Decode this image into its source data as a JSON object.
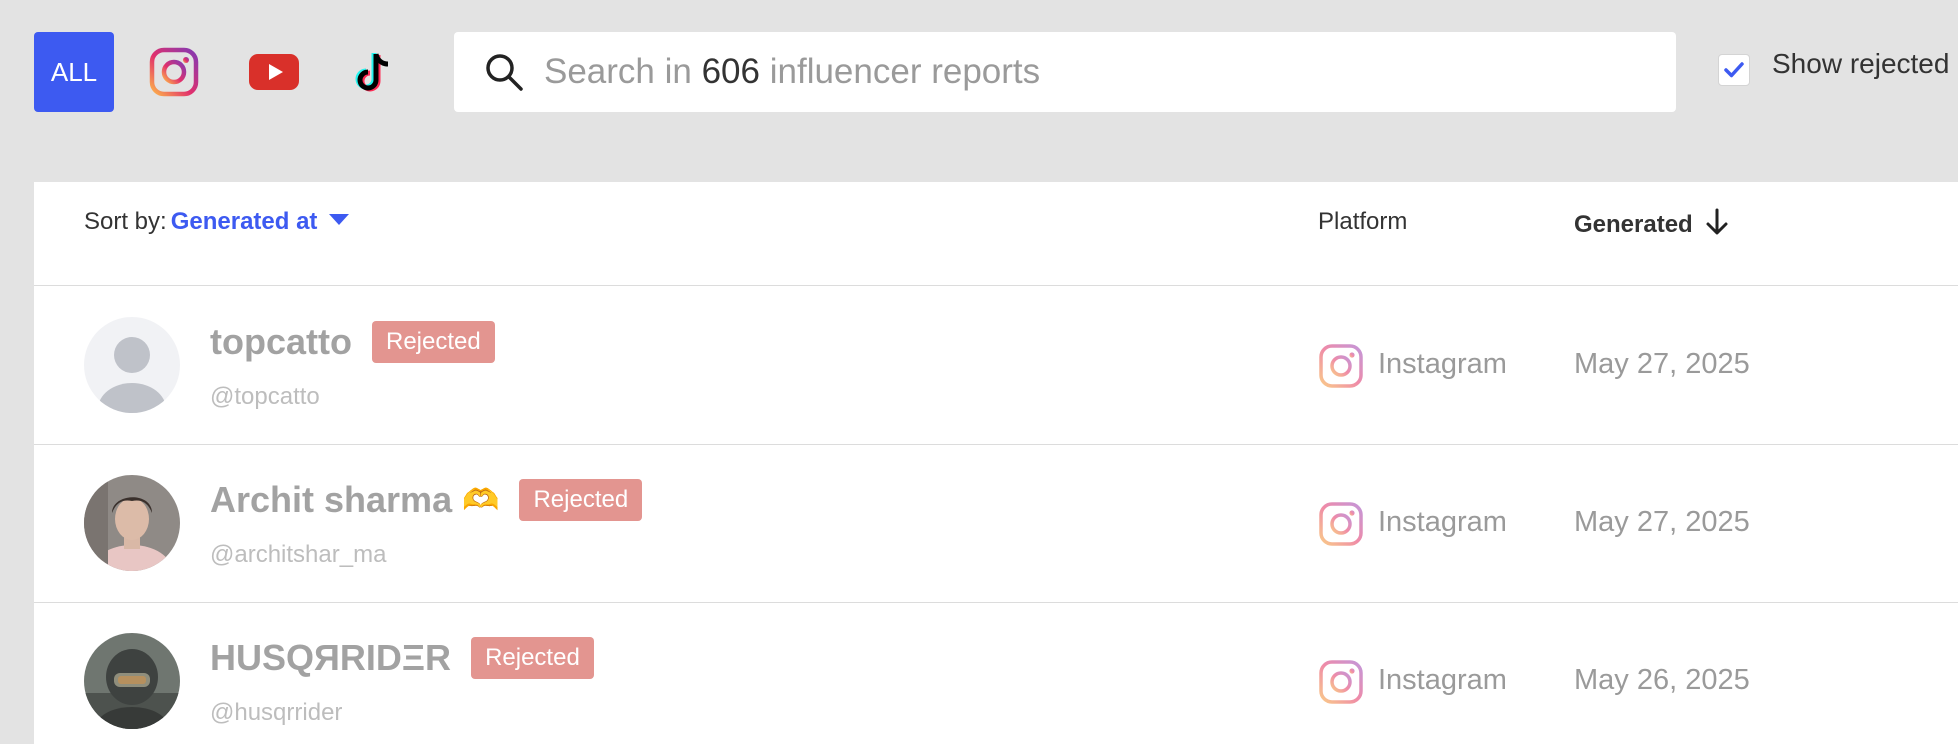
{
  "filters": {
    "all_label": "ALL",
    "platforms": [
      {
        "icon": "instagram-icon",
        "color": "#e1306c"
      },
      {
        "icon": "youtube-icon",
        "color": "#d9302a"
      },
      {
        "icon": "tiktok-icon",
        "color": "#000000"
      }
    ],
    "accent": "#3d5af1"
  },
  "search": {
    "prefix": "Search in ",
    "count": "606",
    "suffix": " influencer reports"
  },
  "show_rejected": {
    "checked": true,
    "label": "Show rejected"
  },
  "list": {
    "sort_label": "Sort by:",
    "sort_value": "Generated at",
    "col_platform": "Platform",
    "col_generated": "Generated"
  },
  "rows": [
    {
      "name": "topcatto",
      "emoji": "",
      "handle": "@topcatto",
      "status": "Rejected",
      "platform": "Instagram",
      "date": "May 27, 2025",
      "avatar": "default-avatar"
    },
    {
      "name": "Archit sharma",
      "emoji": "🫶",
      "handle": "@architshar_ma",
      "status": "Rejected",
      "platform": "Instagram",
      "date": "May 27, 2025",
      "avatar": "profile-photo"
    },
    {
      "name": "HUSQЯRIDΞR",
      "emoji": "",
      "handle": "@husqrrider",
      "status": "Rejected",
      "platform": "Instagram",
      "date": "May 26, 2025",
      "avatar": "profile-photo"
    }
  ],
  "colors": {
    "rejected_badge": "#e39590",
    "background": "#e3e3e3"
  }
}
